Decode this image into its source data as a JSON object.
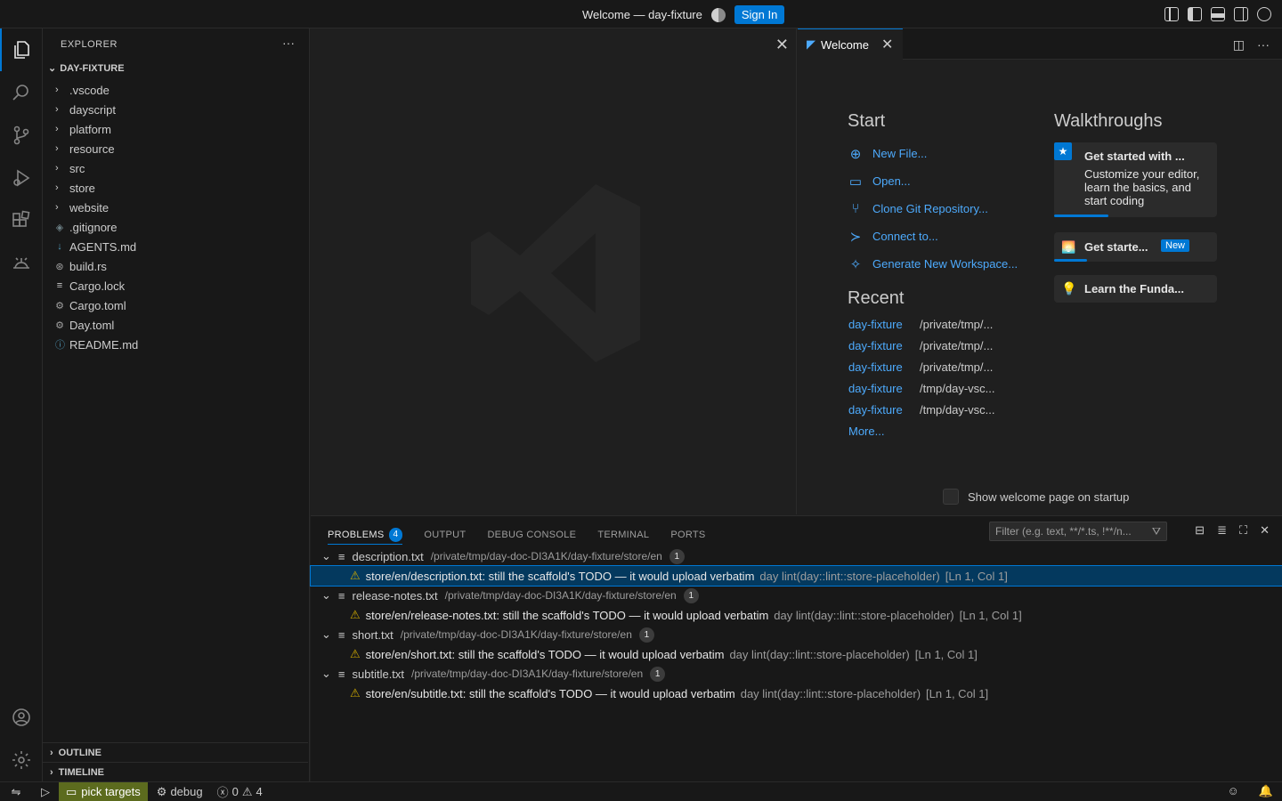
{
  "titlebar": {
    "title": "Welcome — day-fixture",
    "signin_label": "Sign In"
  },
  "activity": {
    "items": [
      "explorer-icon",
      "search-icon",
      "source-control-icon",
      "run-debug-icon",
      "extensions-icon",
      "remote-icon",
      "accounts-icon",
      "settings-gear-icon"
    ]
  },
  "sidebar": {
    "header": "EXPLORER",
    "more": "···",
    "root": "DAY-FIXTURE",
    "items": [
      {
        "label": ".vscode",
        "type": "folder"
      },
      {
        "label": "dayscript",
        "type": "folder"
      },
      {
        "label": "platform",
        "type": "folder"
      },
      {
        "label": "resource",
        "type": "folder"
      },
      {
        "label": "src",
        "type": "folder"
      },
      {
        "label": "store",
        "type": "folder"
      },
      {
        "label": "website",
        "type": "folder"
      },
      {
        "label": ".gitignore",
        "type": "file",
        "icon": "◈",
        "color": "#6d8086"
      },
      {
        "label": "AGENTS.md",
        "type": "file",
        "icon": "↓",
        "color": "#519aba"
      },
      {
        "label": "build.rs",
        "type": "file",
        "icon": "⊛",
        "color": "#a0a0a0"
      },
      {
        "label": "Cargo.lock",
        "type": "file",
        "icon": "≡",
        "color": "#cccccc"
      },
      {
        "label": "Cargo.toml",
        "type": "file",
        "icon": "⚙",
        "color": "#a0a0a0"
      },
      {
        "label": "Day.toml",
        "type": "file",
        "icon": "⚙",
        "color": "#a0a0a0"
      },
      {
        "label": "README.md",
        "type": "file",
        "icon": "ⓘ",
        "color": "#519aba"
      }
    ],
    "outline": "OUTLINE",
    "timeline": "TIMELINE"
  },
  "editor_right": {
    "tab_label": "Welcome",
    "start_title": "Start",
    "start_items": [
      {
        "label": "New File...",
        "icon": "⊕"
      },
      {
        "label": "Open...",
        "icon": "▭"
      },
      {
        "label": "Clone Git Repository...",
        "icon": "⑂"
      },
      {
        "label": "Connect to...",
        "icon": "≻"
      },
      {
        "label": "Generate New Workspace...",
        "icon": "✧"
      }
    ],
    "recent_title": "Recent",
    "recent_items": [
      {
        "name": "day-fixture",
        "path": "/private/tmp/..."
      },
      {
        "name": "day-fixture",
        "path": "/private/tmp/..."
      },
      {
        "name": "day-fixture",
        "path": "/private/tmp/..."
      },
      {
        "name": "day-fixture",
        "path": "/tmp/day-vsc..."
      },
      {
        "name": "day-fixture",
        "path": "/tmp/day-vsc..."
      }
    ],
    "recent_more": "More...",
    "walkthroughs_title": "Walkthroughs",
    "walk1_title": "Get started with ...",
    "walk1_desc": "Customize your editor, learn the basics, and start coding",
    "walk2_title": "Get starte...",
    "walk2_badge": "New",
    "walk3_title": "Learn the Funda...",
    "startup_label": "Show welcome page on startup"
  },
  "panel": {
    "tabs": [
      {
        "label": "PROBLEMS",
        "badge": "4"
      },
      {
        "label": "OUTPUT"
      },
      {
        "label": "DEBUG CONSOLE"
      },
      {
        "label": "TERMINAL"
      },
      {
        "label": "PORTS"
      }
    ],
    "filter_placeholder": "Filter (e.g. text, **/*.ts, !**/n...",
    "problems": [
      {
        "file": "description.txt",
        "path": "/private/tmp/day-doc-DI3A1K/day-fixture/store/en",
        "count": "1",
        "message": "store/en/description.txt: still the scaffold's TODO — it would upload verbatim",
        "source": "day lint(day::lint::store-placeholder)",
        "loc": "[Ln 1, Col 1]"
      },
      {
        "file": "release-notes.txt",
        "path": "/private/tmp/day-doc-DI3A1K/day-fixture/store/en",
        "count": "1",
        "message": "store/en/release-notes.txt: still the scaffold's TODO — it would upload verbatim",
        "source": "day lint(day::lint::store-placeholder)",
        "loc": "[Ln 1, Col 1]"
      },
      {
        "file": "short.txt",
        "path": "/private/tmp/day-doc-DI3A1K/day-fixture/store/en",
        "count": "1",
        "message": "store/en/short.txt: still the scaffold's TODO — it would upload verbatim",
        "source": "day lint(day::lint::store-placeholder)",
        "loc": "[Ln 1, Col 1]"
      },
      {
        "file": "subtitle.txt",
        "path": "/private/tmp/day-doc-DI3A1K/day-fixture/store/en",
        "count": "1",
        "message": "store/en/subtitle.txt: still the scaffold's TODO — it would upload verbatim",
        "source": "day lint(day::lint::store-placeholder)",
        "loc": "[Ln 1, Col 1]"
      }
    ]
  },
  "statusbar": {
    "target_label": "pick targets",
    "debug_label": "debug",
    "errors": "0",
    "warnings": "4"
  },
  "colors": {
    "accent": "#0078d4",
    "link": "#4daafc",
    "warning": "#cca700",
    "target_bg": "#5c6b1e"
  }
}
